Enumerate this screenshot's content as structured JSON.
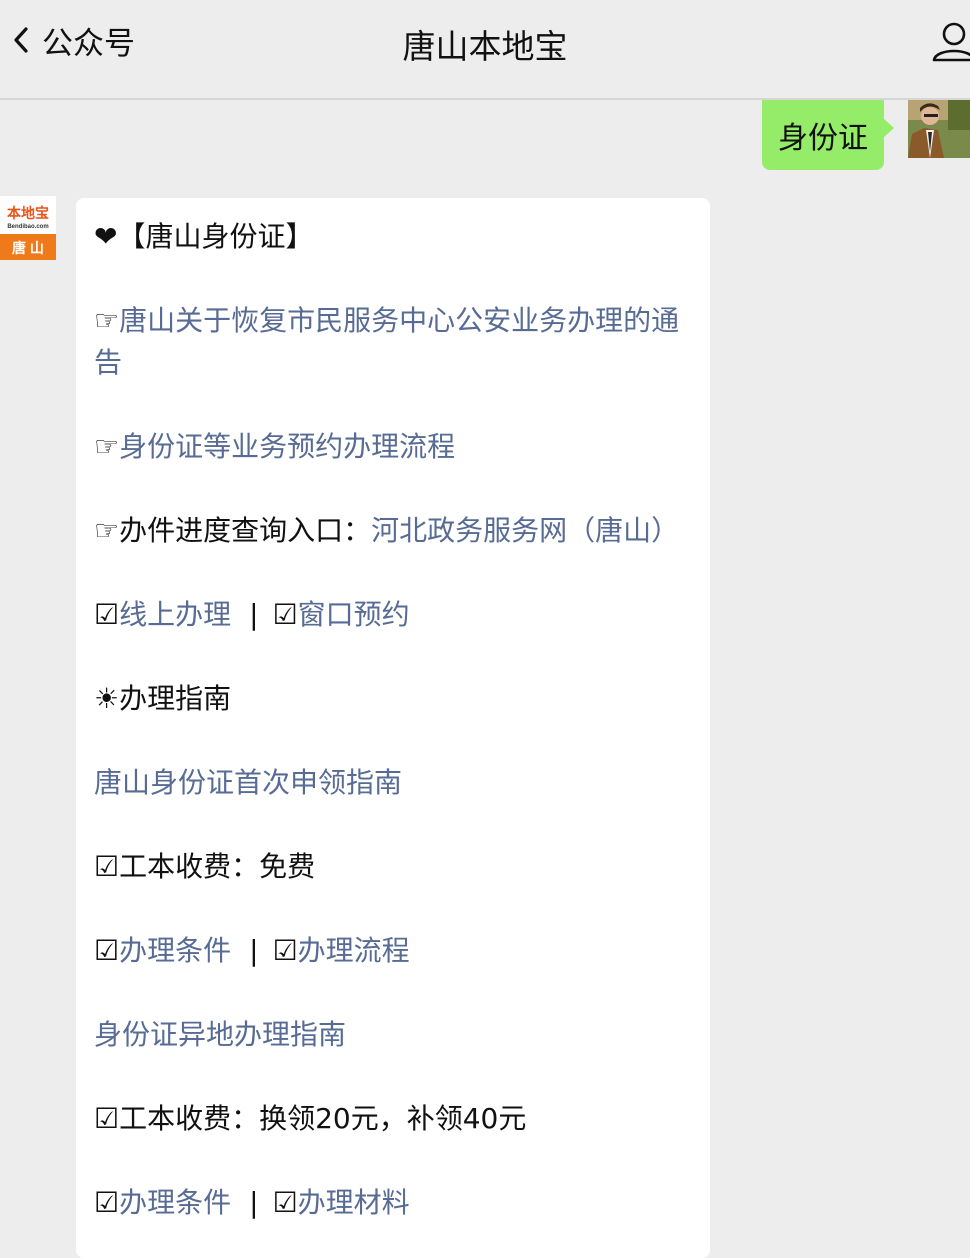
{
  "header": {
    "back_label": "公众号",
    "title": "唐山本地宝"
  },
  "outgoing": {
    "text": "身份证"
  },
  "incoming_avatar": {
    "brand": "本地宝",
    "domain": "Bendibao.com",
    "city": "唐山"
  },
  "message": {
    "heading_icon": "❤",
    "heading": "【唐山身份证】",
    "pointer": "☞",
    "checkbox": "☑",
    "sun": "☀",
    "separator": "|",
    "notice_link": "唐山关于恢复市民服务中心公安业务办理的通告",
    "appointment_link": "身份证等业务预约办理流程",
    "progress_label": "办件进度查询入口：",
    "progress_link": "河北政务服务网（唐山）",
    "online_link": "线上办理",
    "window_link": "窗口预约",
    "guide_label": "办理指南",
    "first_apply_link": "唐山身份证首次申领指南",
    "fee1": "工本收费：免费",
    "conditions_link_1": "办理条件",
    "process_link": "办理流程",
    "remote_link": "身份证异地办理指南",
    "fee2": "工本收费：换领20元，补领40元",
    "conditions_link_2": "办理条件",
    "materials_link": "办理材料"
  },
  "colors": {
    "background": "#ededed",
    "bubble_out": "#95ec69",
    "bubble_in": "#ffffff",
    "link": "#576b95",
    "brand_orange": "#f07a1a"
  }
}
